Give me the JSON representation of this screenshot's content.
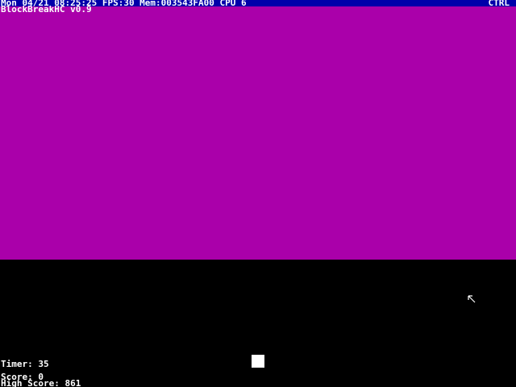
{
  "status_bar": {
    "left_text": "Mon 04/21 08:25:25 FPS:30 Mem:003543FA00 CPU 6",
    "right_text": "CTRL",
    "background": "#0000aa"
  },
  "game": {
    "title": "BlockBreakHC v0.9",
    "playfield_color": "#aa00aa",
    "background_color": "#000000"
  },
  "hud": {
    "timer": "Timer: 35",
    "score": "Score: 0",
    "high_score": "High Score: 861"
  },
  "icons": {
    "cursor": "mouse-pointer-icon"
  }
}
